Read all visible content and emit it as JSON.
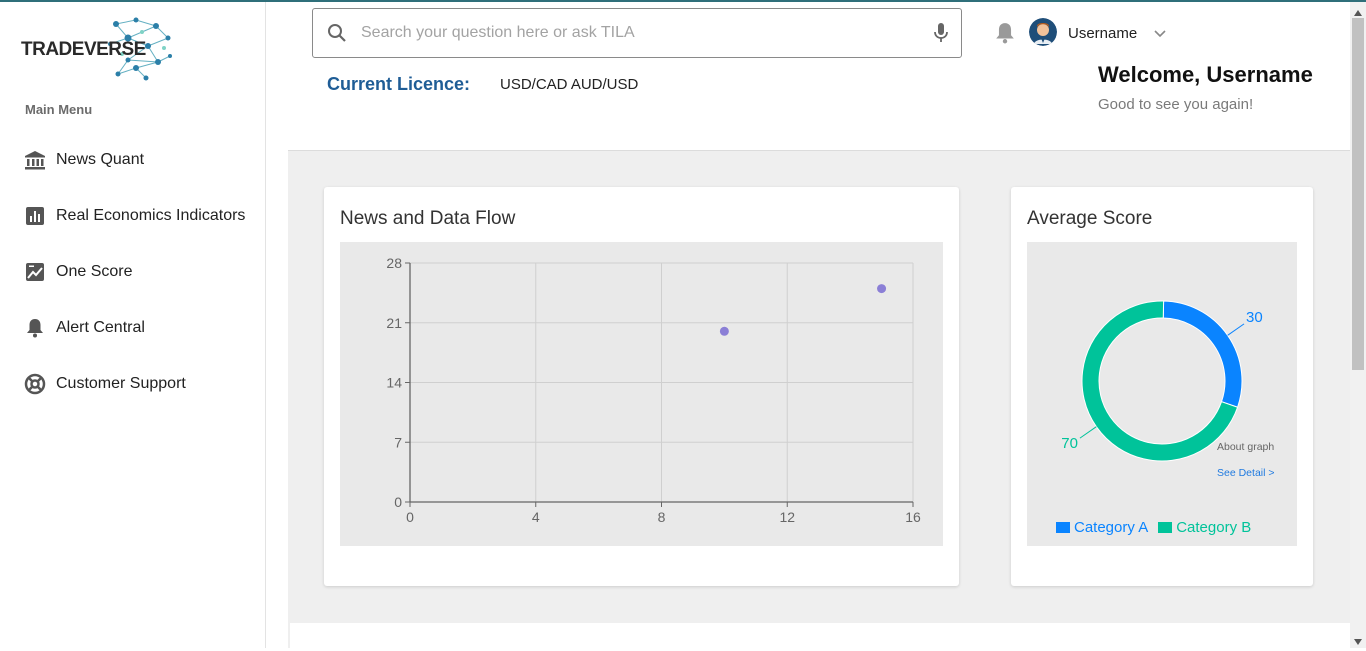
{
  "brand": {
    "name": "TRADEVERSE"
  },
  "sidebar": {
    "heading": "Main Menu",
    "items": [
      {
        "label": "News Quant",
        "icon": "bank-icon"
      },
      {
        "label": "Real Economics Indicators",
        "icon": "bar-chart-icon"
      },
      {
        "label": "One Score",
        "icon": "score-chart-icon"
      },
      {
        "label": "Alert Central",
        "icon": "bell-icon"
      },
      {
        "label": "Customer Support",
        "icon": "lifebuoy-icon"
      }
    ]
  },
  "header": {
    "search_placeholder": "Search your question here or ask TILA",
    "username": "Username",
    "licence_label": "Current Licence:",
    "licence_value": "USD/CAD AUD/USD",
    "welcome": "Welcome, Username",
    "welcome_sub": "Good to see you again!"
  },
  "cards": {
    "news": {
      "title": "News and Data Flow"
    },
    "score": {
      "title": "Average Score",
      "about": "About graph",
      "see_detail": "See Detail >"
    }
  },
  "colors": {
    "accent_blue": "#1f5d96",
    "category_a": "#0a84ff",
    "category_b": "#00c39a",
    "scatter_point": "#8b7fd6"
  },
  "chart_data": [
    {
      "type": "scatter",
      "title": "News and Data Flow",
      "xlim": [
        0,
        16
      ],
      "ylim": [
        0,
        28
      ],
      "x_ticks": [
        0,
        4,
        8,
        12,
        16
      ],
      "y_ticks": [
        0,
        7,
        14,
        21,
        28
      ],
      "grid": true,
      "points": [
        {
          "x": 10,
          "y": 20
        },
        {
          "x": 15,
          "y": 25
        }
      ]
    },
    {
      "type": "pie",
      "title": "Average Score",
      "donut": true,
      "slices": [
        {
          "name": "Category A",
          "value": 30,
          "color": "#0a84ff"
        },
        {
          "name": "Category B",
          "value": 70,
          "color": "#00c39a"
        }
      ],
      "legend_placement": "bottom"
    }
  ]
}
